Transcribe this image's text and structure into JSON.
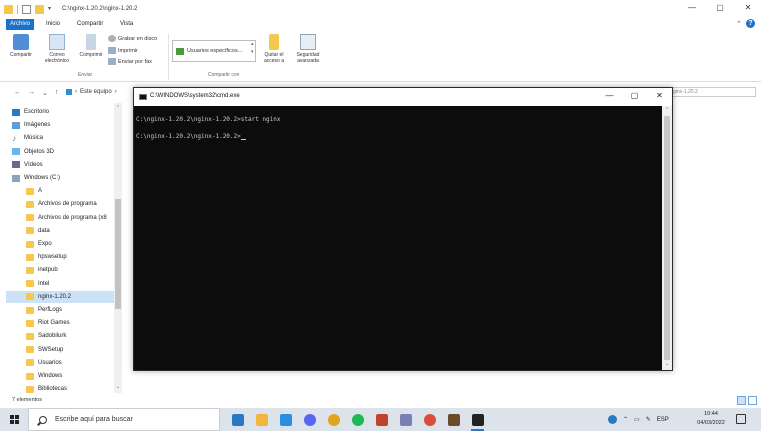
{
  "explorer": {
    "title_path": "C:\\nginx-1.20.2\\nginx-1.20.2",
    "window_controls": [
      "—",
      "▢",
      "✕"
    ],
    "tabs": [
      {
        "label": "Archivo",
        "active": true
      },
      {
        "label": "Inicio",
        "active": false
      },
      {
        "label": "Compartir",
        "active": false
      },
      {
        "label": "Vista",
        "active": false
      }
    ],
    "ribbon": {
      "share_button": "Compartir",
      "email_button_line1": "Correo",
      "email_button_line2": "electrónico",
      "compress_button": "Comprimir",
      "burn_disc": "Grabar en disco",
      "print": "Imprimir",
      "fax": "Enviar por fax",
      "group_send": "Enviar",
      "share_with_combo": "Usuarios específicos...",
      "remove_access_line1": "Quitar el",
      "remove_access_line2": "acceso a",
      "advanced_security_line1": "Seguridad",
      "advanced_security_line2": "avanzada",
      "group_share_with": "Compartir con"
    },
    "address": {
      "crumb": "Este equipo",
      "search_tail": "ginx-1.20.2"
    },
    "nav_items": [
      {
        "label": "Escritorio",
        "icon": "desktop-icon"
      },
      {
        "label": "Imágenes",
        "icon": "pictures-icon"
      },
      {
        "label": "Música",
        "icon": "music-icon"
      },
      {
        "label": "Objetos 3D",
        "icon": "objects3d-icon"
      },
      {
        "label": "Vídeos",
        "icon": "videos-icon"
      },
      {
        "label": "Windows (C:)",
        "icon": "drive-icon"
      },
      {
        "label": "A",
        "icon": "folder-icon"
      },
      {
        "label": "Archivos de programa",
        "icon": "folder-icon"
      },
      {
        "label": "Archivos de programa (x8",
        "icon": "folder-icon"
      },
      {
        "label": "data",
        "icon": "folder-icon"
      },
      {
        "label": "Expo",
        "icon": "folder-icon"
      },
      {
        "label": "hpswsetup",
        "icon": "folder-icon"
      },
      {
        "label": "inetpub",
        "icon": "folder-icon"
      },
      {
        "label": "Intel",
        "icon": "folder-icon"
      },
      {
        "label": "nginx-1.20.2",
        "icon": "folder-icon",
        "selected": true
      },
      {
        "label": "PerfLogs",
        "icon": "folder-icon"
      },
      {
        "label": "Riot Games",
        "icon": "folder-icon"
      },
      {
        "label": "Sadobilurk",
        "icon": "folder-icon"
      },
      {
        "label": "SWSetup",
        "icon": "folder-icon"
      },
      {
        "label": "Usuarios",
        "icon": "folder-icon"
      },
      {
        "label": "Windows",
        "icon": "folder-icon"
      },
      {
        "label": "Bibliotecas",
        "icon": "folder-icon"
      }
    ],
    "status": "7 elementos"
  },
  "cmd": {
    "title": "C:\\WINDOWS\\system32\\cmd.exe",
    "window_controls": [
      "—",
      "▢",
      "✕"
    ],
    "lines": [
      "C:\\nginx-1.20.2\\nginx-1.20.2>start nginx",
      "C:\\nginx-1.20.2\\nginx-1.20.2>"
    ]
  },
  "taskbar": {
    "search_placeholder": "Escribe aquí para buscar",
    "apps": [
      {
        "name": "taskview-app",
        "color": "#2b78c4"
      },
      {
        "name": "file-explorer-app",
        "color": "#f2b63c"
      },
      {
        "name": "vscode-app",
        "color": "#2b8ee0"
      },
      {
        "name": "discord-app",
        "color": "#5865f2"
      },
      {
        "name": "chrome-app",
        "color": "#e0a41e"
      },
      {
        "name": "spotify-app",
        "color": "#1db954"
      },
      {
        "name": "browser-app",
        "color": "#c0432c"
      },
      {
        "name": "minus-app",
        "color": "#7a7fb6"
      },
      {
        "name": "chrome-canary-app",
        "color": "#d94e3a"
      },
      {
        "name": "game-app",
        "color": "#6b4b2a"
      },
      {
        "name": "terminal-app",
        "color": "#222222",
        "active": true
      }
    ],
    "tray_lang": "ESP",
    "time": "10:44",
    "date": "04/03/2022"
  },
  "colors": {
    "accent": "#1a73c9",
    "cmd_bg": "#0c0c0c",
    "cmd_text": "#cccccc",
    "selection": "#cce3f7",
    "taskbar_bg": "#dde3ea"
  }
}
